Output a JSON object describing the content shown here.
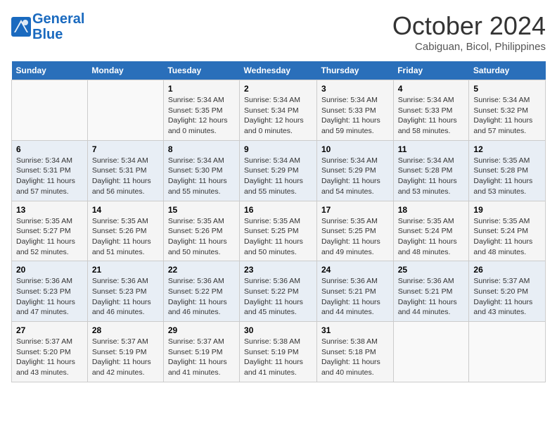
{
  "header": {
    "logo_line1": "General",
    "logo_line2": "Blue",
    "month_title": "October 2024",
    "subtitle": "Cabiguan, Bicol, Philippines"
  },
  "weekdays": [
    "Sunday",
    "Monday",
    "Tuesday",
    "Wednesday",
    "Thursday",
    "Friday",
    "Saturday"
  ],
  "weeks": [
    [
      {
        "day": "",
        "detail": ""
      },
      {
        "day": "",
        "detail": ""
      },
      {
        "day": "1",
        "detail": "Sunrise: 5:34 AM\nSunset: 5:35 PM\nDaylight: 12 hours\nand 0 minutes."
      },
      {
        "day": "2",
        "detail": "Sunrise: 5:34 AM\nSunset: 5:34 PM\nDaylight: 12 hours\nand 0 minutes."
      },
      {
        "day": "3",
        "detail": "Sunrise: 5:34 AM\nSunset: 5:33 PM\nDaylight: 11 hours\nand 59 minutes."
      },
      {
        "day": "4",
        "detail": "Sunrise: 5:34 AM\nSunset: 5:33 PM\nDaylight: 11 hours\nand 58 minutes."
      },
      {
        "day": "5",
        "detail": "Sunrise: 5:34 AM\nSunset: 5:32 PM\nDaylight: 11 hours\nand 57 minutes."
      }
    ],
    [
      {
        "day": "6",
        "detail": "Sunrise: 5:34 AM\nSunset: 5:31 PM\nDaylight: 11 hours\nand 57 minutes."
      },
      {
        "day": "7",
        "detail": "Sunrise: 5:34 AM\nSunset: 5:31 PM\nDaylight: 11 hours\nand 56 minutes."
      },
      {
        "day": "8",
        "detail": "Sunrise: 5:34 AM\nSunset: 5:30 PM\nDaylight: 11 hours\nand 55 minutes."
      },
      {
        "day": "9",
        "detail": "Sunrise: 5:34 AM\nSunset: 5:29 PM\nDaylight: 11 hours\nand 55 minutes."
      },
      {
        "day": "10",
        "detail": "Sunrise: 5:34 AM\nSunset: 5:29 PM\nDaylight: 11 hours\nand 54 minutes."
      },
      {
        "day": "11",
        "detail": "Sunrise: 5:34 AM\nSunset: 5:28 PM\nDaylight: 11 hours\nand 53 minutes."
      },
      {
        "day": "12",
        "detail": "Sunrise: 5:35 AM\nSunset: 5:28 PM\nDaylight: 11 hours\nand 53 minutes."
      }
    ],
    [
      {
        "day": "13",
        "detail": "Sunrise: 5:35 AM\nSunset: 5:27 PM\nDaylight: 11 hours\nand 52 minutes."
      },
      {
        "day": "14",
        "detail": "Sunrise: 5:35 AM\nSunset: 5:26 PM\nDaylight: 11 hours\nand 51 minutes."
      },
      {
        "day": "15",
        "detail": "Sunrise: 5:35 AM\nSunset: 5:26 PM\nDaylight: 11 hours\nand 50 minutes."
      },
      {
        "day": "16",
        "detail": "Sunrise: 5:35 AM\nSunset: 5:25 PM\nDaylight: 11 hours\nand 50 minutes."
      },
      {
        "day": "17",
        "detail": "Sunrise: 5:35 AM\nSunset: 5:25 PM\nDaylight: 11 hours\nand 49 minutes."
      },
      {
        "day": "18",
        "detail": "Sunrise: 5:35 AM\nSunset: 5:24 PM\nDaylight: 11 hours\nand 48 minutes."
      },
      {
        "day": "19",
        "detail": "Sunrise: 5:35 AM\nSunset: 5:24 PM\nDaylight: 11 hours\nand 48 minutes."
      }
    ],
    [
      {
        "day": "20",
        "detail": "Sunrise: 5:36 AM\nSunset: 5:23 PM\nDaylight: 11 hours\nand 47 minutes."
      },
      {
        "day": "21",
        "detail": "Sunrise: 5:36 AM\nSunset: 5:23 PM\nDaylight: 11 hours\nand 46 minutes."
      },
      {
        "day": "22",
        "detail": "Sunrise: 5:36 AM\nSunset: 5:22 PM\nDaylight: 11 hours\nand 46 minutes."
      },
      {
        "day": "23",
        "detail": "Sunrise: 5:36 AM\nSunset: 5:22 PM\nDaylight: 11 hours\nand 45 minutes."
      },
      {
        "day": "24",
        "detail": "Sunrise: 5:36 AM\nSunset: 5:21 PM\nDaylight: 11 hours\nand 44 minutes."
      },
      {
        "day": "25",
        "detail": "Sunrise: 5:36 AM\nSunset: 5:21 PM\nDaylight: 11 hours\nand 44 minutes."
      },
      {
        "day": "26",
        "detail": "Sunrise: 5:37 AM\nSunset: 5:20 PM\nDaylight: 11 hours\nand 43 minutes."
      }
    ],
    [
      {
        "day": "27",
        "detail": "Sunrise: 5:37 AM\nSunset: 5:20 PM\nDaylight: 11 hours\nand 43 minutes."
      },
      {
        "day": "28",
        "detail": "Sunrise: 5:37 AM\nSunset: 5:19 PM\nDaylight: 11 hours\nand 42 minutes."
      },
      {
        "day": "29",
        "detail": "Sunrise: 5:37 AM\nSunset: 5:19 PM\nDaylight: 11 hours\nand 41 minutes."
      },
      {
        "day": "30",
        "detail": "Sunrise: 5:38 AM\nSunset: 5:19 PM\nDaylight: 11 hours\nand 41 minutes."
      },
      {
        "day": "31",
        "detail": "Sunrise: 5:38 AM\nSunset: 5:18 PM\nDaylight: 11 hours\nand 40 minutes."
      },
      {
        "day": "",
        "detail": ""
      },
      {
        "day": "",
        "detail": ""
      }
    ]
  ]
}
